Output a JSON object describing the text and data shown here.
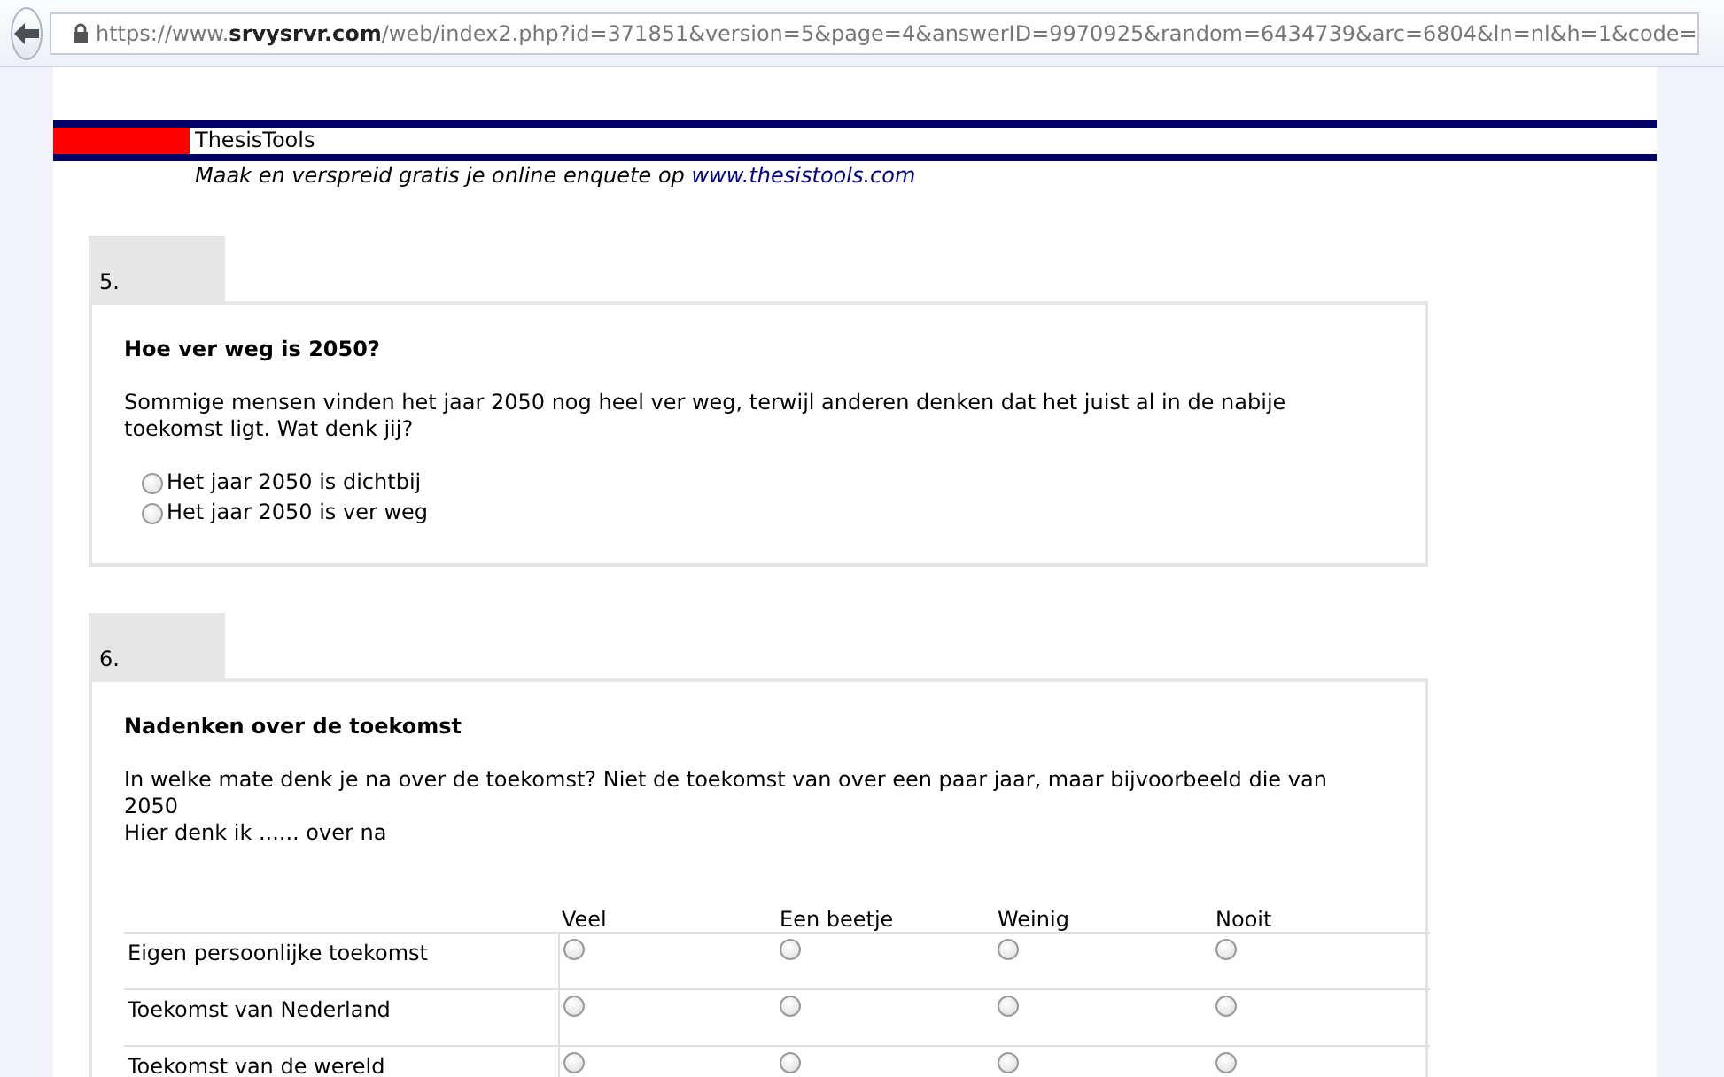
{
  "browser": {
    "url": "https://www.**srvysrvr.com**/web/index2.php?id=371851&version=5&page=4&answerID=9970925&random=6434739&arc=6804&ln=nl&h=1&code="
  },
  "header": {
    "brand": "ThesisTools",
    "tagline": "Maak en verspreid gratis je online enquete op",
    "link": "www.thesistools.com"
  },
  "questions": [
    {
      "kind": "choice",
      "number": "5.",
      "title": "Hoe ver weg is 2050?",
      "text": [
        "Sommige mensen vinden het jaar 2050 nog heel ver weg, terwijl anderen denken dat het juist al in de nabije toekomst ligt. Wat denk jij?"
      ],
      "options": [
        {
          "label": "Het jaar 2050 is dichtbij",
          "selected": false
        },
        {
          "label": "Het jaar 2050 is ver weg",
          "selected": false
        }
      ]
    },
    {
      "kind": "matrix",
      "number": "6.",
      "title": "Nadenken over de toekomst",
      "text": [
        "In welke mate denk je na over de toekomst? Niet de toekomst van over een paar jaar, maar bijvoorbeeld die van 2050",
        "Hier denk ik ...... over na"
      ],
      "columns": [
        "Veel",
        "Een beetje",
        "Weinig",
        "Nooit"
      ],
      "rows": [
        {
          "label": "Eigen persoonlijke toekomst",
          "cells": [
            {
              "selected": false
            },
            {
              "selected": false
            },
            {
              "selected": false
            },
            {
              "selected": false
            }
          ]
        },
        {
          "label": "Toekomst van Nederland",
          "cells": [
            {
              "selected": false
            },
            {
              "selected": false
            },
            {
              "selected": false
            },
            {
              "selected": false
            }
          ]
        },
        {
          "label": "Toekomst van de wereld",
          "cells": [
            {
              "selected": false
            },
            {
              "selected": false
            },
            {
              "selected": false
            },
            {
              "selected": false
            }
          ]
        }
      ]
    }
  ]
}
